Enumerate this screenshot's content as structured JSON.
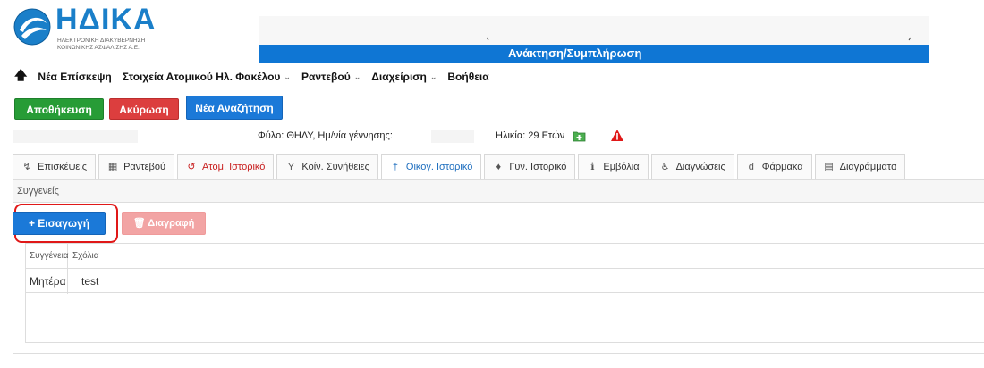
{
  "header": {
    "logo_name": "ΗΔΙΚΑ",
    "logo_sub_line1": "ΗΛΕΚΤΡΟΝΙΚΗ ΔΙΑΚΥΒΕΡΝΗΣΗ",
    "logo_sub_line2": "ΚΟΙΝΩΝΙΚΗΣ ΑΣΦΑΛΙΣΗΣ Α.Ε.",
    "banner_text": "Ανάκτηση/Συμπλήρωση"
  },
  "menu": {
    "back_icon": "up-arrow-icon",
    "items": [
      {
        "label": "Νέα Επίσκεψη",
        "has_dropdown": false
      },
      {
        "label": "Στοιχεία Ατομικού Ηλ. Φακέλου",
        "has_dropdown": true
      },
      {
        "label": "Ραντεβού",
        "has_dropdown": true
      },
      {
        "label": "Διαχείριση",
        "has_dropdown": true
      },
      {
        "label": "Βοήθεια",
        "has_dropdown": false
      }
    ]
  },
  "toolbar": {
    "save_label": "Αποθήκευση",
    "cancel_label": "Ακύρωση",
    "new_search_label": "Νέα Αναζήτηση"
  },
  "patient": {
    "gender_dob": "Φύλο: ΘΗΛΥ,  Ημ/νία γέννησης:",
    "age": "Ηλικία: 29 Ετών"
  },
  "tabs": [
    {
      "label": "Επισκέψεις",
      "icon": "history-icon",
      "state": "normal"
    },
    {
      "label": "Ραντεβού",
      "icon": "calendar-icon",
      "state": "normal"
    },
    {
      "label": "Ατομ. Ιστορικό",
      "icon": "rotate-icon",
      "state": "red"
    },
    {
      "label": "Κοίν. Συνήθειες",
      "icon": "filter-icon",
      "state": "normal"
    },
    {
      "label": "Οικογ. Ιστορικό",
      "icon": "person-icon",
      "state": "active"
    },
    {
      "label": "Γυν. Ιστορικό",
      "icon": "female-icon",
      "state": "normal"
    },
    {
      "label": "Εμβόλια",
      "icon": "info-icon",
      "state": "normal"
    },
    {
      "label": "Διαγνώσεις",
      "icon": "wheelchair-icon",
      "state": "normal"
    },
    {
      "label": "Φάρμακα",
      "icon": "pill-icon",
      "state": "normal"
    },
    {
      "label": "Διαγράμματα",
      "icon": "chart-icon",
      "state": "normal"
    }
  ],
  "panel": {
    "title": "Συγγενείς",
    "insert_label": "+ Εισαγωγή",
    "delete_label": "🗑 Διαγραφή",
    "table": {
      "headers": [
        "Συγγένεια",
        "Σχόλια"
      ],
      "rows": [
        [
          "Μητέρα",
          "test"
        ]
      ]
    }
  },
  "colors": {
    "brand_blue": "#0f76d4",
    "save_green": "#279c36",
    "cancel_red": "#dc3e3e",
    "highlight_red": "#e01818"
  }
}
